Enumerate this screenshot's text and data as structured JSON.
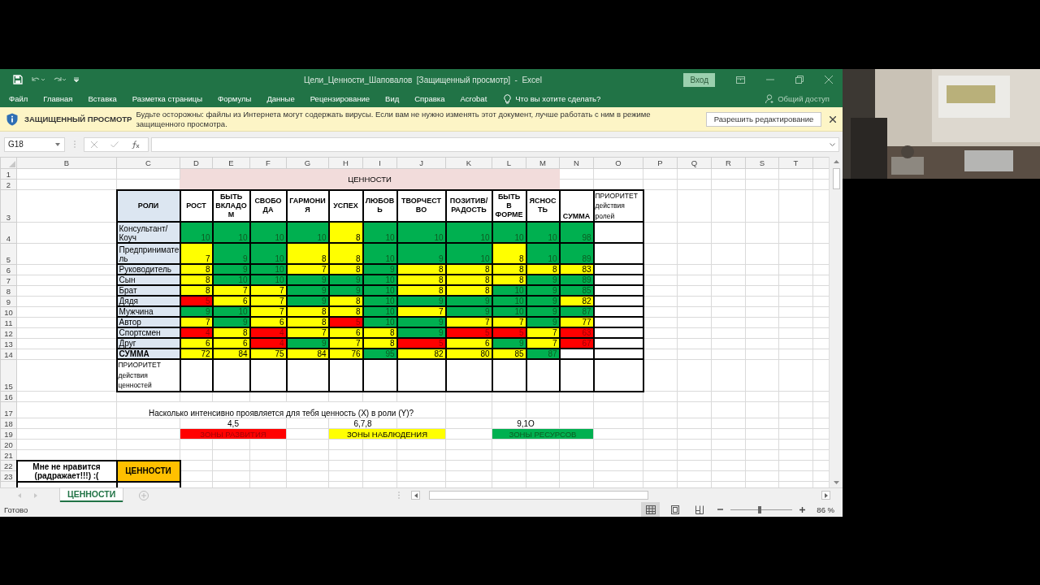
{
  "title_bar": {
    "title": "Цели_Ценности_Шаповалов  [Защищенный просмотр]  -  Excel",
    "signin": "Вход"
  },
  "ribbon": {
    "tabs": [
      "Файл",
      "Главная",
      "Вставка",
      "Разметка страницы",
      "Формулы",
      "Данные",
      "Рецензирование",
      "Вид",
      "Справка",
      "Acrobat"
    ],
    "tell_me": "Что вы хотите сделать?",
    "share": {
      "label": "Общий доступ",
      "disabled": true
    }
  },
  "protected_view": {
    "title": "ЗАЩИЩЕННЫЙ ПРОСМОТР",
    "message": "Будьте осторожны: файлы из Интернета могут содержать вирусы. Если вам не нужно изменять этот документ, лучше работать с ним в режиме защищенного просмотра.",
    "button": "Разрешить редактирование"
  },
  "formula_bar": {
    "name_box": "G18"
  },
  "sheet": {
    "columns": [
      "B",
      "C",
      "D",
      "E",
      "F",
      "G",
      "H",
      "I",
      "J",
      "K",
      "L",
      "M",
      "N",
      "O",
      "P",
      "Q",
      "R",
      "S",
      "T"
    ],
    "rows": [
      "1",
      "2",
      "3",
      "4",
      "5",
      "6",
      "7",
      "8",
      "9",
      "10",
      "11",
      "12",
      "13",
      "14",
      "15",
      "16",
      "17",
      "18",
      "19",
      "20",
      "21",
      "22",
      "23"
    ],
    "header_band": "ЦЕННОСТИ",
    "table": {
      "corner": "РОЛИ",
      "values": [
        "РОСТ",
        "БЫТЬ ВКЛАДОМ",
        "СВОБОДА",
        "ГАРМОНИЯ",
        "УСПЕХ",
        "ЛЮБОВЬ",
        "ТВОРЧЕСТВО",
        "ПОЗИТИВ/РАДОСТЬ",
        "БЫТЬ  В ФОРМЕ",
        "ЯСНОСТЬ"
      ],
      "total_label": "СУММА",
      "priority_label": "ПРИОРИТЕТ действия ролей",
      "roles": [
        {
          "name": "Консультант/Коуч",
          "scores": [
            {
              "value": "10",
              "color": "#00b050"
            },
            {
              "value": "10",
              "color": "#00b050"
            },
            {
              "value": "10",
              "color": "#00b050"
            },
            {
              "value": "10",
              "color": "#00b050"
            },
            {
              "value": "8",
              "color": "#ffff00"
            },
            {
              "value": "10",
              "color": "#00b050"
            },
            {
              "value": "10",
              "color": "#00b050"
            },
            {
              "value": "10",
              "color": "#00b050"
            },
            {
              "value": "10",
              "color": "#00b050"
            },
            {
              "value": "10",
              "color": "#00b050"
            }
          ],
          "total": {
            "value": "98",
            "color": "#00b050"
          }
        },
        {
          "name": "Предприниматель",
          "scores": [
            {
              "value": "7",
              "color": "#ffff00"
            },
            {
              "value": "9",
              "color": "#00b050"
            },
            {
              "value": "10",
              "color": "#00b050"
            },
            {
              "value": "8",
              "color": "#ffff00"
            },
            {
              "value": "8",
              "color": "#ffff00"
            },
            {
              "value": "10",
              "color": "#00b050"
            },
            {
              "value": "9",
              "color": "#00b050"
            },
            {
              "value": "10",
              "color": "#00b050"
            },
            {
              "value": "8",
              "color": "#ffff00"
            },
            {
              "value": "10",
              "color": "#00b050"
            }
          ],
          "total": {
            "value": "89",
            "color": "#00b050"
          }
        },
        {
          "name": "Руководитель",
          "scores": [
            {
              "value": "8",
              "color": "#ffff00"
            },
            {
              "value": "9",
              "color": "#00b050"
            },
            {
              "value": "10",
              "color": "#00b050"
            },
            {
              "value": "7",
              "color": "#ffff00"
            },
            {
              "value": "8",
              "color": "#ffff00"
            },
            {
              "value": "9",
              "color": "#00b050"
            },
            {
              "value": "8",
              "color": "#ffff00"
            },
            {
              "value": "8",
              "color": "#ffff00"
            },
            {
              "value": "8",
              "color": "#ffff00"
            },
            {
              "value": "8",
              "color": "#ffff00"
            }
          ],
          "total": {
            "value": "83",
            "color": "#ffff00"
          }
        },
        {
          "name": "Сын",
          "scores": [
            {
              "value": "8",
              "color": "#ffff00"
            },
            {
              "value": "10",
              "color": "#00b050"
            },
            {
              "value": "10",
              "color": "#00b050"
            },
            {
              "value": "9",
              "color": "#00b050"
            },
            {
              "value": "9",
              "color": "#00b050"
            },
            {
              "value": "10",
              "color": "#00b050"
            },
            {
              "value": "8",
              "color": "#ffff00"
            },
            {
              "value": "8",
              "color": "#ffff00"
            },
            {
              "value": "8",
              "color": "#ffff00"
            },
            {
              "value": "9",
              "color": "#00b050"
            }
          ],
          "total": {
            "value": "89",
            "color": "#00b050"
          }
        },
        {
          "name": "Брат",
          "scores": [
            {
              "value": "8",
              "color": "#ffff00"
            },
            {
              "value": "7",
              "color": "#ffff00"
            },
            {
              "value": "7",
              "color": "#ffff00"
            },
            {
              "value": "9",
              "color": "#00b050"
            },
            {
              "value": "9",
              "color": "#00b050"
            },
            {
              "value": "10",
              "color": "#00b050"
            },
            {
              "value": "8",
              "color": "#ffff00"
            },
            {
              "value": "8",
              "color": "#ffff00"
            },
            {
              "value": "10",
              "color": "#00b050"
            },
            {
              "value": "9",
              "color": "#00b050"
            }
          ],
          "total": {
            "value": "85",
            "color": "#00b050"
          }
        },
        {
          "name": "Дядя",
          "scores": [
            {
              "value": "5",
              "color": "#ff0000"
            },
            {
              "value": "6",
              "color": "#ffff00"
            },
            {
              "value": "7",
              "color": "#ffff00"
            },
            {
              "value": "9",
              "color": "#00b050"
            },
            {
              "value": "8",
              "color": "#ffff00"
            },
            {
              "value": "10",
              "color": "#00b050"
            },
            {
              "value": "9",
              "color": "#00b050"
            },
            {
              "value": "9",
              "color": "#00b050"
            },
            {
              "value": "10",
              "color": "#00b050"
            },
            {
              "value": "9",
              "color": "#00b050"
            }
          ],
          "total": {
            "value": "82",
            "color": "#ffff00"
          }
        },
        {
          "name": "Мужчина",
          "scores": [
            {
              "value": "9",
              "color": "#00b050"
            },
            {
              "value": "10",
              "color": "#00b050"
            },
            {
              "value": "7",
              "color": "#ffff00"
            },
            {
              "value": "8",
              "color": "#ffff00"
            },
            {
              "value": "8",
              "color": "#ffff00"
            },
            {
              "value": "10",
              "color": "#00b050"
            },
            {
              "value": "7",
              "color": "#ffff00"
            },
            {
              "value": "9",
              "color": "#00b050"
            },
            {
              "value": "10",
              "color": "#00b050"
            },
            {
              "value": "9",
              "color": "#00b050"
            }
          ],
          "total": {
            "value": "87",
            "color": "#00b050"
          }
        },
        {
          "name": "Автор",
          "scores": [
            {
              "value": "7",
              "color": "#ffff00"
            },
            {
              "value": "9",
              "color": "#00b050"
            },
            {
              "value": "6",
              "color": "#ffff00"
            },
            {
              "value": "8",
              "color": "#ffff00"
            },
            {
              "value": "5",
              "color": "#ff0000"
            },
            {
              "value": "10",
              "color": "#00b050"
            },
            {
              "value": "9",
              "color": "#00b050"
            },
            {
              "value": "7",
              "color": "#ffff00"
            },
            {
              "value": "7",
              "color": "#ffff00"
            },
            {
              "value": "9",
              "color": "#00b050"
            }
          ],
          "total": {
            "value": "77",
            "color": "#ffff00"
          }
        },
        {
          "name": "Спортсмен",
          "scores": [
            {
              "value": "4",
              "color": "#ff0000"
            },
            {
              "value": "8",
              "color": "#ffff00"
            },
            {
              "value": "4",
              "color": "#ff0000"
            },
            {
              "value": "7",
              "color": "#ffff00"
            },
            {
              "value": "6",
              "color": "#ffff00"
            },
            {
              "value": "8",
              "color": "#ffff00"
            },
            {
              "value": "9",
              "color": "#00b050"
            },
            {
              "value": "5",
              "color": "#ff0000"
            },
            {
              "value": "5",
              "color": "#ff0000"
            },
            {
              "value": "7",
              "color": "#ffff00"
            }
          ],
          "total": {
            "value": "63",
            "color": "#ff0000"
          }
        },
        {
          "name": "Друг",
          "scores": [
            {
              "value": "6",
              "color": "#ffff00"
            },
            {
              "value": "6",
              "color": "#ffff00"
            },
            {
              "value": "4",
              "color": "#ff0000"
            },
            {
              "value": "9",
              "color": "#00b050"
            },
            {
              "value": "7",
              "color": "#ffff00"
            },
            {
              "value": "8",
              "color": "#ffff00"
            },
            {
              "value": "5",
              "color": "#ff0000"
            },
            {
              "value": "6",
              "color": "#ffff00"
            },
            {
              "value": "9",
              "color": "#00b050"
            },
            {
              "value": "7",
              "color": "#ffff00"
            }
          ],
          "total": {
            "value": "67",
            "color": "#ff0000"
          }
        }
      ],
      "sum_row": {
        "label": "СУММА",
        "scores": [
          {
            "value": "72",
            "color": "#ffff00"
          },
          {
            "value": "84",
            "color": "#ffff00"
          },
          {
            "value": "75",
            "color": "#ffff00"
          },
          {
            "value": "84",
            "color": "#ffff00"
          },
          {
            "value": "76",
            "color": "#ffff00"
          },
          {
            "value": "95",
            "color": "#00b050"
          },
          {
            "value": "82",
            "color": "#ffff00"
          },
          {
            "value": "80",
            "color": "#ffff00"
          },
          {
            "value": "85",
            "color": "#ffff00"
          },
          {
            "value": "87",
            "color": "#00b050"
          }
        ]
      },
      "value_priority_label": "ПРИОРИТЕТ действия ценностей"
    },
    "question": "Насколько интенсивно проявляется для тебя ценность (X) в роли (Y)?",
    "legend": [
      {
        "range": "4,5",
        "label": "ЗОНЫ РАЗВИТИЯ",
        "color": "#ff0000"
      },
      {
        "range": "6,7,8",
        "label": "ЗОНЫ НАБЛЮДЕНИЯ",
        "color": "#ffff00"
      },
      {
        "range": "9,1О",
        "label": "ЗОНЫ РЕСУРСОВ",
        "color": "#00b050"
      }
    ],
    "dislike_header": "Мне не нравится (радражает!!!) :(",
    "values_header": "ЦЕННОСТИ"
  },
  "sheet_tabs": [
    {
      "label": "ЦЕННОСТИ",
      "selected": true
    }
  ],
  "status_bar": {
    "status": "Готово",
    "views": [
      {
        "kind": "normal",
        "selected": true
      },
      {
        "kind": "page_layout",
        "selected": false
      },
      {
        "kind": "page_break",
        "selected": false
      }
    ],
    "zoom": {
      "level": 0.47,
      "reading": "86 %"
    }
  }
}
